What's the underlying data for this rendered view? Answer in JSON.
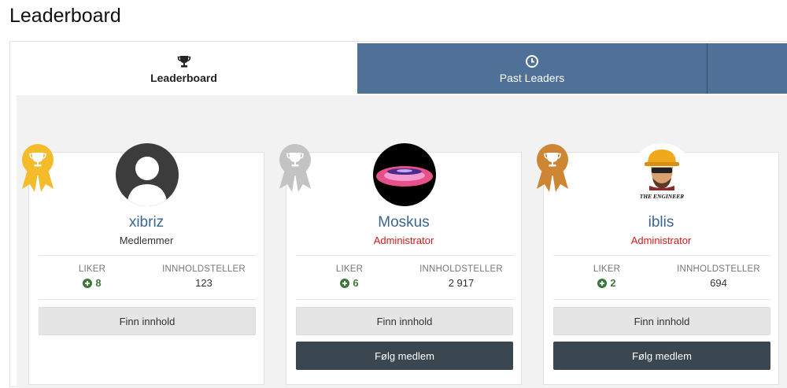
{
  "page": {
    "title": "Leaderboard"
  },
  "tabs": {
    "leaderboard": {
      "label": "Leaderboard",
      "icon": "trophy-icon"
    },
    "past_leaders": {
      "label": "Past Leaders",
      "icon": "clock-icon"
    }
  },
  "stat_labels": {
    "likes": "LIKER",
    "content": "INNHOLDSTELLER"
  },
  "buttons": {
    "find_content": "Finn innhold",
    "follow": "Følg medlem"
  },
  "members": [
    {
      "rank_badge": "gold",
      "name": "xibriz",
      "group": "Medlemmer",
      "likes": "8",
      "content_count": "123",
      "can_follow": false
    },
    {
      "rank_badge": "silver",
      "name": "Moskus",
      "group": "Administrator",
      "likes": "6",
      "content_count": "2 917",
      "can_follow": true
    },
    {
      "rank_badge": "bronze",
      "name": "iblis",
      "group": "Administrator",
      "likes": "2",
      "content_count": "694",
      "can_follow": true
    }
  ],
  "colors": {
    "tab_blue": "#4f7198",
    "gold": "#f4bb2a",
    "silver": "#c3c3c3",
    "bronze": "#cd8634",
    "admin_red": "#cc1a1a",
    "name_blue": "#3d6594",
    "follow_btn": "#3a4650"
  },
  "avatar_caption": "THE ENGINEER"
}
